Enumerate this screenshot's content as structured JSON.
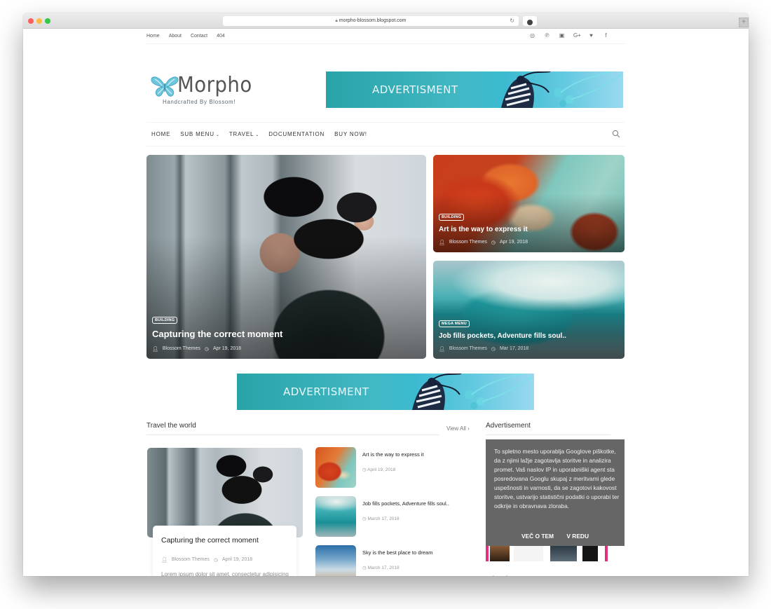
{
  "browser": {
    "url": "morpho-blossom.blogspot.com"
  },
  "topbar": {
    "links": [
      "Home",
      "About",
      "Contact",
      "404"
    ],
    "social_icons": [
      "instagram-icon",
      "pinterest-icon",
      "youtube-icon",
      "google-plus-icon",
      "twitter-icon",
      "facebook-icon"
    ],
    "social_glyphs": [
      "◎",
      "℗",
      "▣",
      "G+",
      "♥",
      "f"
    ]
  },
  "header": {
    "logo_text": "Morpho",
    "tagline": "Handcrafted By Blossom!",
    "ad_text": "ADVERTISMENT"
  },
  "nav": {
    "items": [
      {
        "label": "HOME",
        "dropdown": false
      },
      {
        "label": "SUB MENU",
        "dropdown": true
      },
      {
        "label": "TRAVEL",
        "dropdown": true
      },
      {
        "label": "DOCUMENTATION",
        "dropdown": false
      },
      {
        "label": "BUY NOW!",
        "dropdown": false
      }
    ],
    "caret": "⌄"
  },
  "featured": [
    {
      "badge": "BUILDING",
      "title": "Capturing the correct moment",
      "author": "Blossom Themes",
      "date": "Apr 19, 2018"
    },
    {
      "badge": "BUILDING",
      "title": "Art is the way to express it",
      "author": "Blossom Themes",
      "date": "Apr 19, 2018"
    },
    {
      "badge": "MEGA MENU",
      "title": "Job fills pockets, Adventure fills soul..",
      "author": "Blossom Themes",
      "date": "Mar 17, 2018"
    }
  ],
  "mid_ad": {
    "text": "ADVERTISMENT"
  },
  "travel_section": {
    "title": "Travel the world",
    "view_all": "View All ›",
    "main_post": {
      "title": "Capturing the correct moment",
      "author": "Blossom Themes",
      "date": "April 19, 2018",
      "excerpt": "Lorem ipsum dolor sit amet, consectetur adipisicing elit, sed do eiusmod tempor incididunt"
    },
    "list": [
      {
        "title": "Art is the way to express it",
        "date": "April 19, 2018"
      },
      {
        "title": "Job fills pockets, Adventure fills soul..",
        "date": "March 17, 2018"
      },
      {
        "title": "Sky is the best place to dream",
        "date": "March 17, 2018"
      }
    ]
  },
  "sidebar": {
    "widget1_title": "Advertisement",
    "widget2_title": "Advertisement",
    "cookie_notice": {
      "text": "To spletno mesto uporablja Googlove piškotke, da z njimi lažje zagotavlja storitve in analizira promet. Vaš naslov IP in uporabniški agent sta posredovana Googlu skupaj z meritvami glede uspešnosti in varnosti, da se zagotovi kakovost storitve, ustvarijo statistični podatki o uporabi ter odkrije in obravnava zloraba.",
      "learn_more": "VEČ O TEM",
      "ok": "V REDU"
    }
  }
}
